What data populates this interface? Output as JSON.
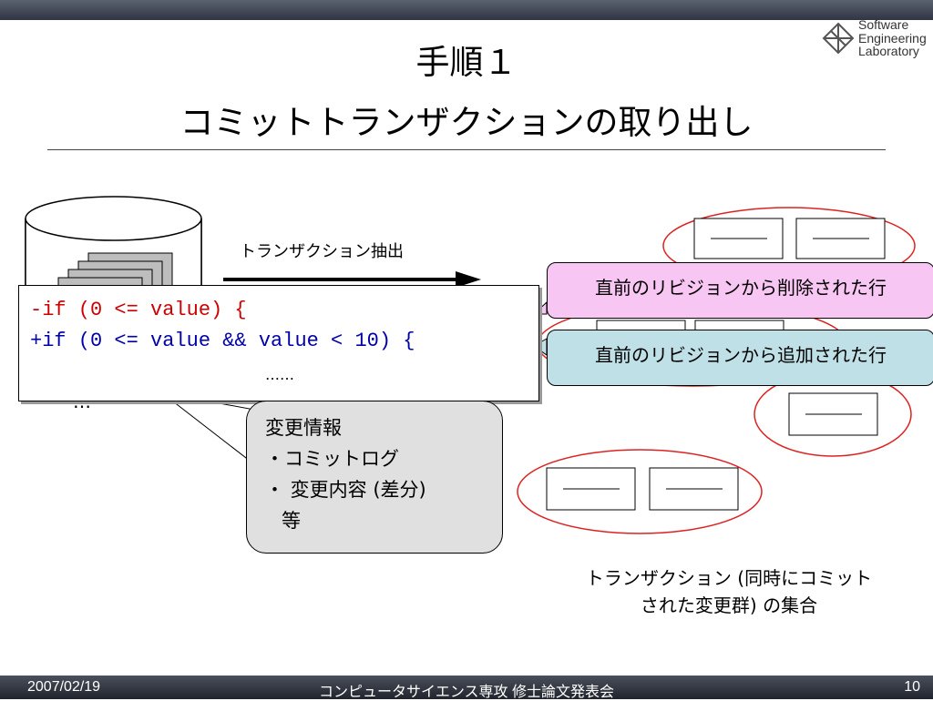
{
  "header": {
    "title_line1": "手順１",
    "title_line2": "コミットトランザクションの取り出し",
    "logo_text": [
      "Software",
      "Engineering",
      "Laboratory"
    ]
  },
  "diagram": {
    "arrow_label": "トランザクション抽出",
    "code_lines": {
      "removed": "-if (0 <= value) {",
      "added": "+if (0 <= value && value < 10) {",
      "ellipsis": "……"
    },
    "removed_callout": "直前のリビジョンから削除された行",
    "added_callout": "直前のリビジョンから追加された行",
    "info": {
      "heading": "変更情報",
      "items": [
        "・コミットログ",
        "・ 変更内容 (差分)",
        "等"
      ]
    },
    "caption_line1": "トランザクション (同時にコミット",
    "caption_line2": "された変更群) の集合",
    "colors": {
      "removed": "#cc0000",
      "added": "#0000aa",
      "removed_bubble": "#f7c6f2",
      "added_bubble": "#bfe0e6",
      "ellipse": "#dd2222",
      "info_bg": "#e0e0e0"
    }
  },
  "footer": {
    "date": "2007/02/19",
    "event": "コンピュータサイエンス専攻 修士論文発表会",
    "page": "10"
  }
}
